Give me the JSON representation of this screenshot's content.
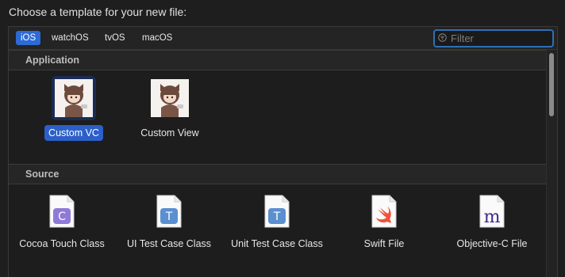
{
  "header": {
    "title": "Choose a template for your new file:"
  },
  "platforms": [
    {
      "label": "iOS",
      "active": true
    },
    {
      "label": "watchOS",
      "active": false
    },
    {
      "label": "tvOS",
      "active": false
    },
    {
      "label": "macOS",
      "active": false
    }
  ],
  "filter": {
    "placeholder": "Filter",
    "value": ""
  },
  "sections": {
    "application": {
      "title": "Application",
      "items": [
        {
          "label": "Custom VC",
          "icon": "avatar-thumbnail-icon",
          "selected": true
        },
        {
          "label": "Custom View",
          "icon": "avatar-thumbnail-icon",
          "selected": false
        }
      ]
    },
    "source": {
      "title": "Source",
      "items": [
        {
          "label": "Cocoa Touch Class",
          "icon": "c-document-icon",
          "glyph": "C",
          "color": "#8f7ad8"
        },
        {
          "label": "UI Test Case Class",
          "icon": "t-document-icon",
          "glyph": "T",
          "color": "#5a8fd0"
        },
        {
          "label": "Unit Test Case Class",
          "icon": "t-document-icon",
          "glyph": "T",
          "color": "#5a8fd0"
        },
        {
          "label": "Swift File",
          "icon": "swift-document-icon",
          "color": "#f05138"
        },
        {
          "label": "Objective-C File",
          "icon": "m-document-icon",
          "glyph": "m",
          "color": "#3f2a8c"
        }
      ]
    }
  }
}
